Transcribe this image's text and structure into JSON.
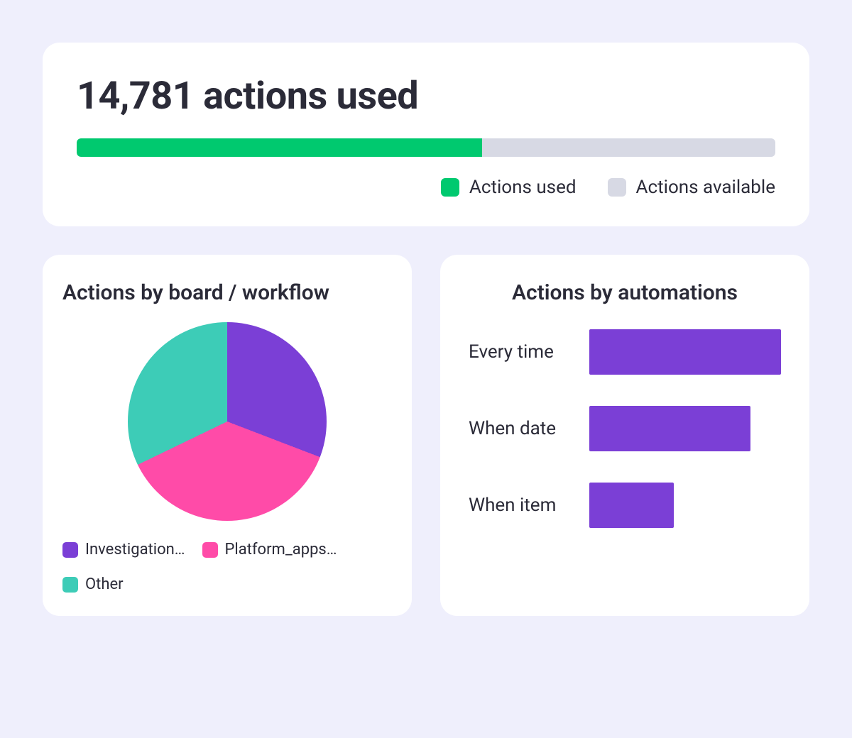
{
  "summary": {
    "title": "14,781 actions used",
    "progress_percent": 58,
    "legend_used": "Actions used",
    "legend_available": "Actions available",
    "color_used": "#00C96F",
    "color_available": "#D7D9E4"
  },
  "pie_card": {
    "title": "Actions by board / workflow",
    "legend": {
      "0": {
        "label": "Investigation…",
        "color": "#7B3FD6"
      },
      "1": {
        "label": "Platform_apps…",
        "color": "#FF4BA8"
      },
      "2": {
        "label": "Other",
        "color": "#3DCCB7"
      }
    }
  },
  "bars_card": {
    "title": "Actions by automations",
    "rows": {
      "0": {
        "label": "Every time",
        "percent": 100
      },
      "1": {
        "label": "When date",
        "percent": 84
      },
      "2": {
        "label": "When item",
        "percent": 44
      }
    },
    "bar_color": "#7B3FD6"
  },
  "chart_data": [
    {
      "type": "bar",
      "title": "14,781 actions used",
      "categories": [
        "Actions used",
        "Actions available"
      ],
      "values": [
        58,
        42
      ],
      "note": "stacked horizontal progress, percent of total"
    },
    {
      "type": "pie",
      "title": "Actions by board / workflow",
      "categories": [
        "Investigation…",
        "Platform_apps…",
        "Other"
      ],
      "values": [
        30,
        37,
        33
      ],
      "colors": [
        "#7B3FD6",
        "#FF4BA8",
        "#3DCCB7"
      ]
    },
    {
      "type": "bar",
      "title": "Actions by automations",
      "categories": [
        "Every time",
        "When date",
        "When item"
      ],
      "values": [
        100,
        84,
        44
      ],
      "colors": [
        "#7B3FD6"
      ],
      "note": "relative bar lengths, percent of max"
    }
  ]
}
